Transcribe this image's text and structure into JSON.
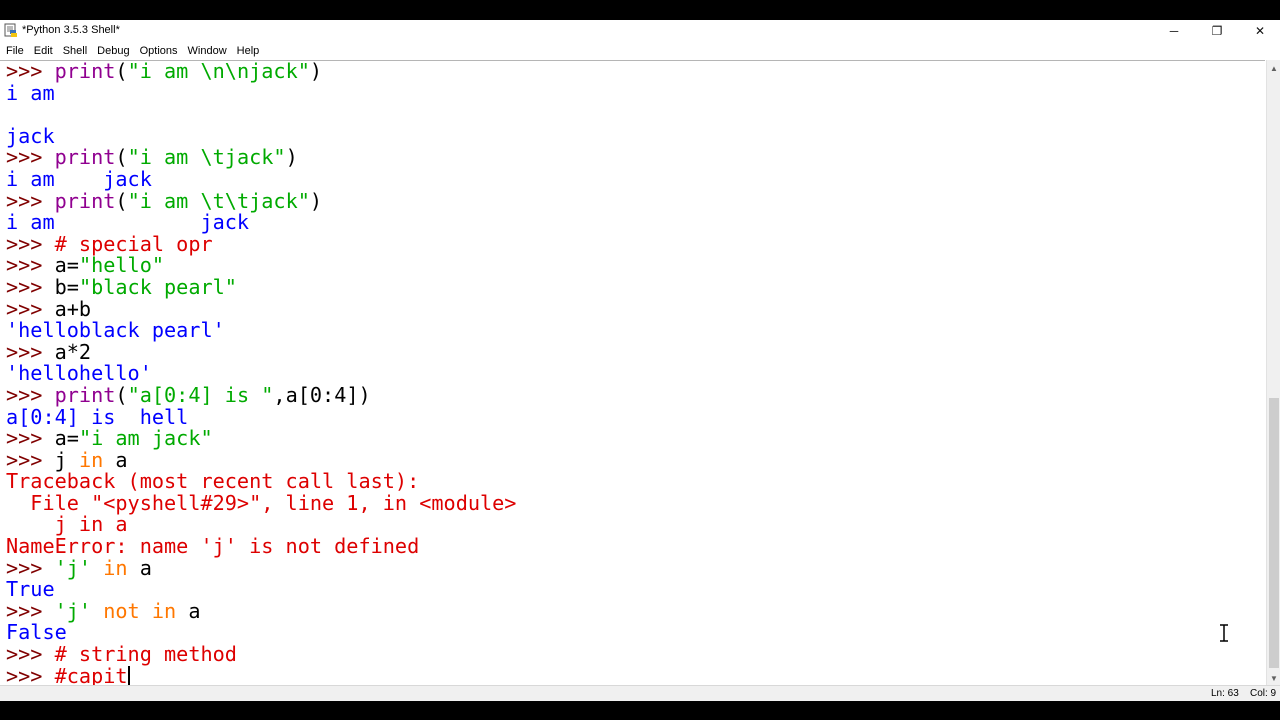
{
  "window": {
    "title": "*Python 3.5.3 Shell*",
    "controls": {
      "minimize": "─",
      "maximize": "❐",
      "close": "✕"
    }
  },
  "menubar": {
    "items": [
      "File",
      "Edit",
      "Shell",
      "Debug",
      "Options",
      "Window",
      "Help"
    ]
  },
  "shell": {
    "lines": [
      [
        {
          "t": ">>> ",
          "c": "prompt"
        },
        {
          "t": "print",
          "c": "builtin"
        },
        {
          "t": "(",
          "c": "def"
        },
        {
          "t": "\"i am \\n\\njack\"",
          "c": "str"
        },
        {
          "t": ")",
          "c": "def"
        }
      ],
      [
        {
          "t": "i am",
          "c": "out"
        }
      ],
      [
        {
          "t": "",
          "c": "out"
        }
      ],
      [
        {
          "t": "jack",
          "c": "out"
        }
      ],
      [
        {
          "t": ">>> ",
          "c": "prompt"
        },
        {
          "t": "print",
          "c": "builtin"
        },
        {
          "t": "(",
          "c": "def"
        },
        {
          "t": "\"i am \\tjack\"",
          "c": "str"
        },
        {
          "t": ")",
          "c": "def"
        }
      ],
      [
        {
          "t": "i am    jack",
          "c": "out"
        }
      ],
      [
        {
          "t": ">>> ",
          "c": "prompt"
        },
        {
          "t": "print",
          "c": "builtin"
        },
        {
          "t": "(",
          "c": "def"
        },
        {
          "t": "\"i am \\t\\tjack\"",
          "c": "str"
        },
        {
          "t": ")",
          "c": "def"
        }
      ],
      [
        {
          "t": "i am            jack",
          "c": "out"
        }
      ],
      [
        {
          "t": ">>> ",
          "c": "prompt"
        },
        {
          "t": "# special opr",
          "c": "comment"
        }
      ],
      [
        {
          "t": ">>> ",
          "c": "prompt"
        },
        {
          "t": "a=",
          "c": "def"
        },
        {
          "t": "\"hello\"",
          "c": "str"
        }
      ],
      [
        {
          "t": ">>> ",
          "c": "prompt"
        },
        {
          "t": "b=",
          "c": "def"
        },
        {
          "t": "\"black pearl\"",
          "c": "str"
        }
      ],
      [
        {
          "t": ">>> ",
          "c": "prompt"
        },
        {
          "t": "a+b",
          "c": "def"
        }
      ],
      [
        {
          "t": "'helloblack pearl'",
          "c": "out"
        }
      ],
      [
        {
          "t": ">>> ",
          "c": "prompt"
        },
        {
          "t": "a*2",
          "c": "def"
        }
      ],
      [
        {
          "t": "'hellohello'",
          "c": "out"
        }
      ],
      [
        {
          "t": ">>> ",
          "c": "prompt"
        },
        {
          "t": "print",
          "c": "builtin"
        },
        {
          "t": "(",
          "c": "def"
        },
        {
          "t": "\"a[0:4] is \"",
          "c": "str"
        },
        {
          "t": ",a[0:4])",
          "c": "def"
        }
      ],
      [
        {
          "t": "a[0:4] is  hell",
          "c": "out"
        }
      ],
      [
        {
          "t": ">>> ",
          "c": "prompt"
        },
        {
          "t": "a=",
          "c": "def"
        },
        {
          "t": "\"i am jack\"",
          "c": "str"
        }
      ],
      [
        {
          "t": ">>> ",
          "c": "prompt"
        },
        {
          "t": "j ",
          "c": "def"
        },
        {
          "t": "in",
          "c": "kw"
        },
        {
          "t": " a",
          "c": "def"
        }
      ],
      [
        {
          "t": "Traceback (most recent call last):",
          "c": "err"
        }
      ],
      [
        {
          "t": "  File \"<pyshell#29>\", line 1, in <module>",
          "c": "err"
        }
      ],
      [
        {
          "t": "    j in a",
          "c": "err"
        }
      ],
      [
        {
          "t": "NameError: name 'j' is not defined",
          "c": "err"
        }
      ],
      [
        {
          "t": ">>> ",
          "c": "prompt"
        },
        {
          "t": "'j'",
          "c": "str"
        },
        {
          "t": " ",
          "c": "def"
        },
        {
          "t": "in",
          "c": "kw"
        },
        {
          "t": " a",
          "c": "def"
        }
      ],
      [
        {
          "t": "True",
          "c": "out"
        }
      ],
      [
        {
          "t": ">>> ",
          "c": "prompt"
        },
        {
          "t": "'j'",
          "c": "str"
        },
        {
          "t": " ",
          "c": "def"
        },
        {
          "t": "not",
          "c": "kw"
        },
        {
          "t": " ",
          "c": "def"
        },
        {
          "t": "in",
          "c": "kw"
        },
        {
          "t": " a",
          "c": "def"
        }
      ],
      [
        {
          "t": "False",
          "c": "out"
        }
      ],
      [
        {
          "t": ">>> ",
          "c": "prompt"
        },
        {
          "t": "# string method",
          "c": "comment"
        }
      ],
      [
        {
          "t": ">>> ",
          "c": "prompt"
        },
        {
          "t": "#capit",
          "c": "comment"
        }
      ]
    ]
  },
  "status": {
    "line": "Ln: 63",
    "column": "Col: 9"
  },
  "colors": {
    "prompt": "#800000",
    "string": "#00aa00",
    "keyword": "#ff7700",
    "builtin": "#900090",
    "comment": "#dd0000",
    "output": "#0000ff",
    "error": "#dd0000"
  },
  "icons": {
    "app": "python-idle-icon",
    "text_cursor": "ibeam-cursor-icon"
  }
}
